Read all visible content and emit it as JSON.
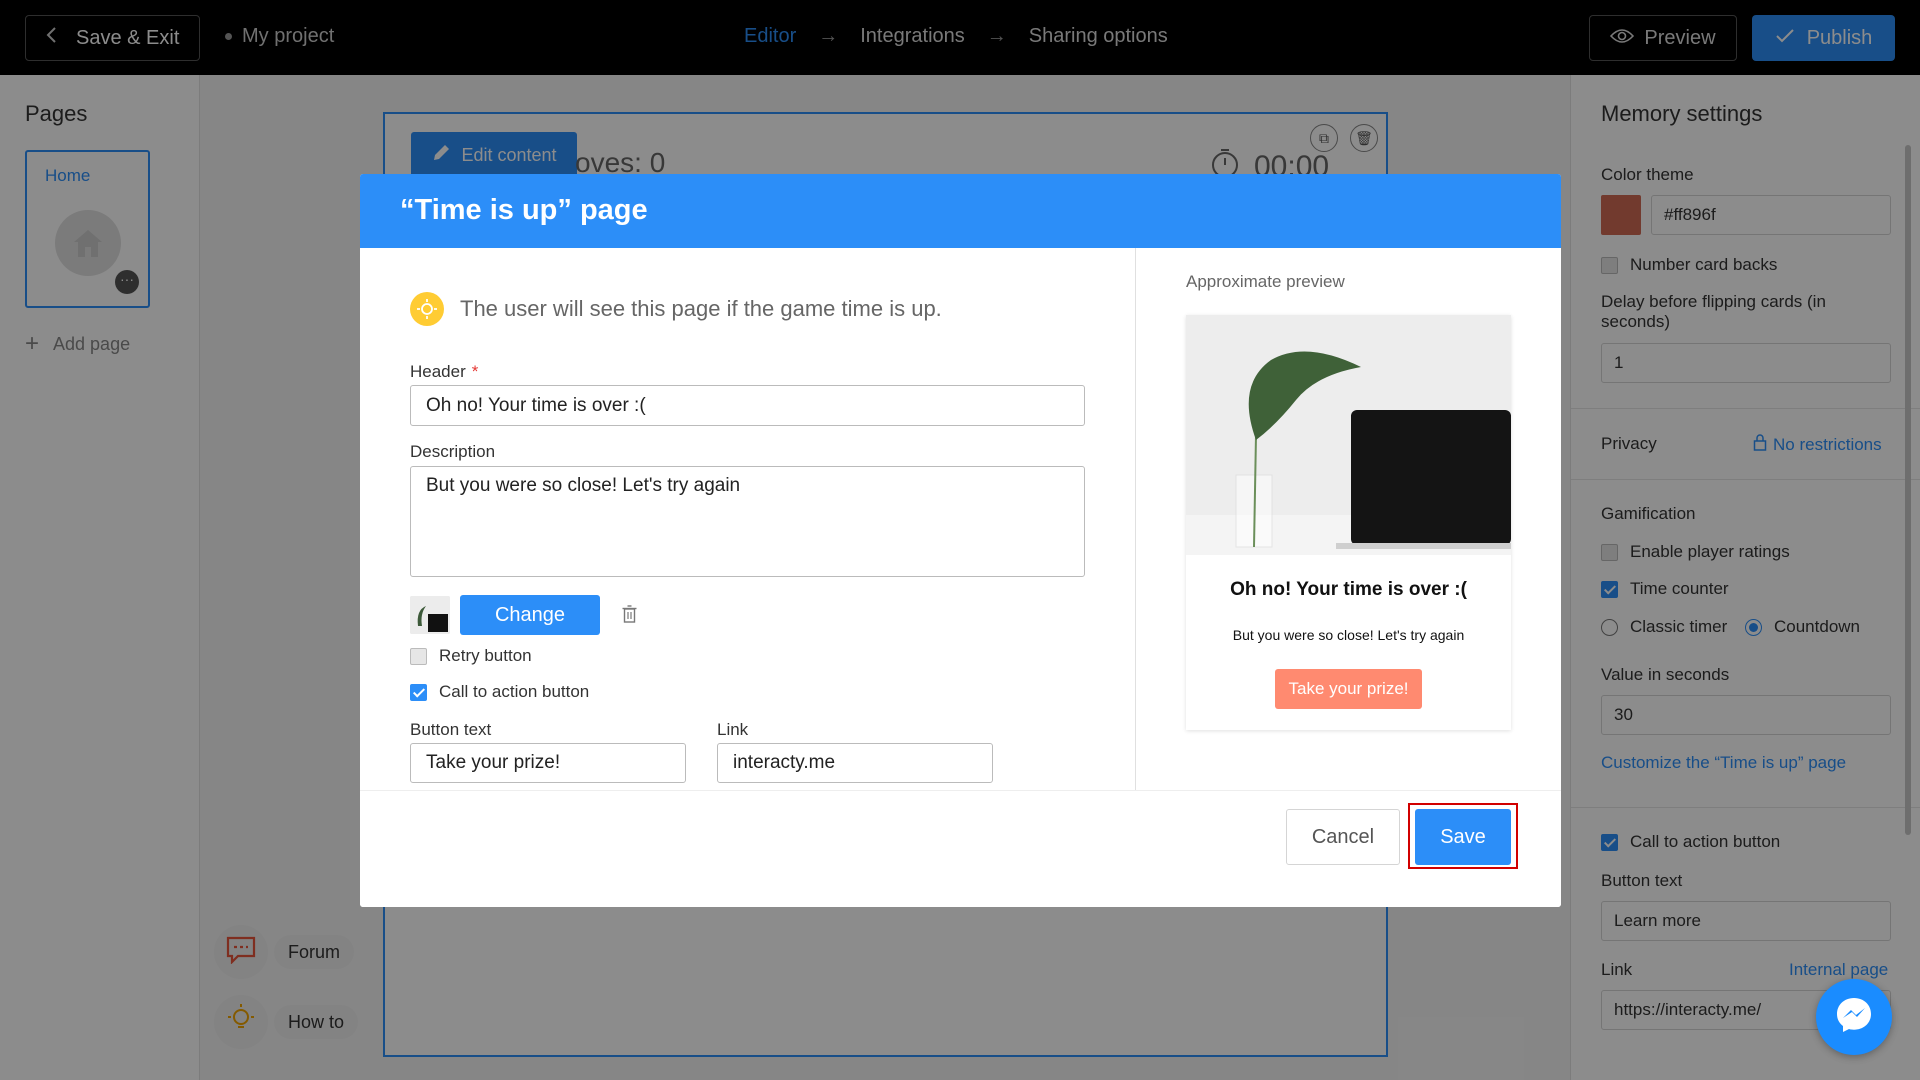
{
  "topbar": {
    "save_exit_label": "Save & Exit",
    "project_name": "My project",
    "steps": [
      "Editor",
      "Integrations",
      "Sharing options"
    ],
    "active_step": "Editor",
    "preview_label": "Preview",
    "publish_label": "Publish"
  },
  "left_panel": {
    "title": "Pages",
    "pages": [
      {
        "label": "Home"
      }
    ],
    "add_page_label": "Add page"
  },
  "canvas": {
    "edit_content_label": "Edit content",
    "moves_text": "oves: 0",
    "timer_text": "00:00"
  },
  "help": {
    "forum_label": "Forum",
    "howto_label": "How to"
  },
  "right_panel": {
    "title": "Memory settings",
    "color_theme_label": "Color theme",
    "color_theme_value": "#ff896f",
    "number_card_backs_label": "Number card backs",
    "number_card_backs_checked": false,
    "delay_label": "Delay before flipping cards (in seconds)",
    "delay_value": "1",
    "privacy_label": "Privacy",
    "privacy_value": "No restrictions",
    "gamification_label": "Gamification",
    "enable_ratings_label": "Enable player ratings",
    "enable_ratings_checked": false,
    "time_counter_label": "Time counter",
    "time_counter_checked": true,
    "classic_timer_label": "Classic timer",
    "countdown_label": "Countdown",
    "timer_mode": "Countdown",
    "value_seconds_label": "Value in seconds",
    "value_seconds": "30",
    "customize_link": "Customize the “Time is up” page",
    "cta_label": "Call to action button",
    "cta_checked": true,
    "button_text_label": "Button text",
    "button_text_value": "Learn more",
    "link_label": "Link",
    "internal_page_link": "Internal page",
    "link_value": "https://interacty.me/"
  },
  "modal": {
    "title": "“Time is up” page",
    "info_text": "The user will see this page if the game time is up.",
    "header_label": "Header",
    "header_required_mark": "*",
    "header_value": "Oh no! Your time is over :(",
    "description_label": "Description",
    "description_value": "But you were so close! Let's try again",
    "change_label": "Change",
    "retry_label": "Retry button",
    "retry_checked": false,
    "cta_label": "Call to action button",
    "cta_checked": true,
    "button_text_label": "Button text",
    "button_text_value": "Take your prize!",
    "link_label": "Link",
    "link_value": "interacty.me",
    "preview_label": "Approximate preview",
    "preview_header": "Oh no! Your time is over :(",
    "preview_description": "But you were so close! Let's try again",
    "preview_button": "Take your prize!",
    "cancel_label": "Cancel",
    "save_label": "Save"
  },
  "colors": {
    "accent": "#2c8ef8",
    "theme": "#ff896f",
    "topbar": "#000000",
    "highlight": "#d10000"
  },
  "icons": [
    "chevron-left-icon",
    "eye-icon",
    "check-icon",
    "home-icon",
    "plus-icon",
    "pencil-icon",
    "copy-icon",
    "trash-icon",
    "stopwatch-icon",
    "chat-icon",
    "bulb-icon",
    "lock-icon",
    "messenger-icon"
  ]
}
